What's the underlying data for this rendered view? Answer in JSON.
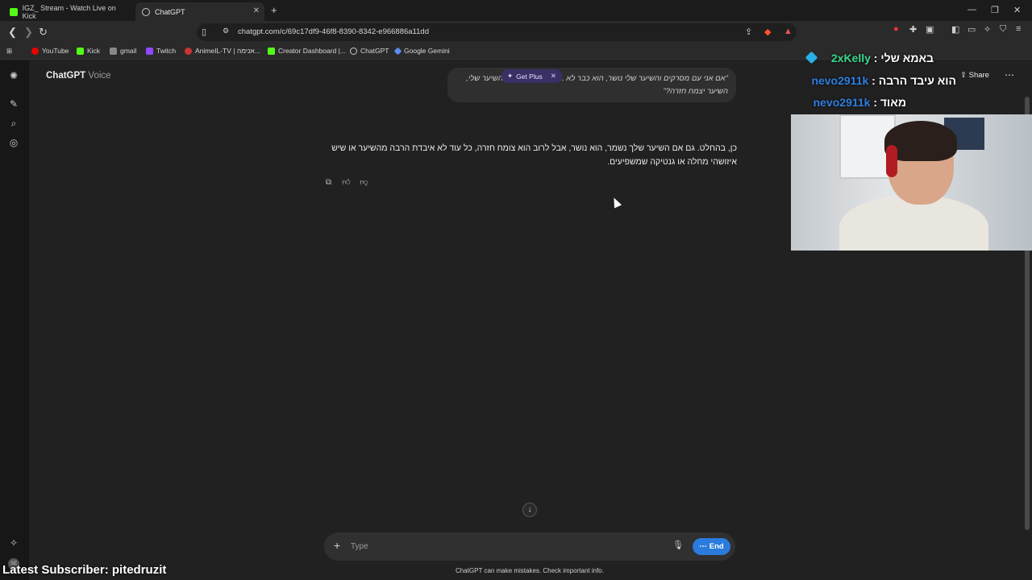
{
  "browser": {
    "tabs": [
      {
        "label": "IGZ_ Stream - Watch Live on Kick",
        "active": false
      },
      {
        "label": "ChatGPT",
        "active": true
      }
    ],
    "url": "chatgpt.com/c/69c17df9-46f8-8390-8342-e966886a11dd",
    "bookmarks": [
      "YouTube",
      "Kick",
      "gmail",
      "Twitch",
      "AnimeIL-TV | אנימה...",
      "Creator Dashboard |...",
      "ChatGPT",
      "Google Gemini"
    ]
  },
  "chatgpt": {
    "brand": "ChatGPT",
    "mode": "Voice",
    "user_message": "\"אם אני עם מסרקים והשיער שלי נושר, הוא כבר לא ... כשאני אגלח את השיער שלי, השיער יצמח חזרה?\"",
    "get_plus": "Get Plus",
    "assistant_message": "כן, בהחלט. גם אם השיער שלך נשמר, הוא נושר, אבל לרוב הוא צומח חזרה, כל עוד לא איבדת הרבה מהשיער או שיש איזושהי מחלה או גנטיקה שמשפיעים.",
    "composer_placeholder": "Type",
    "end_label": "End",
    "share_label": "Share",
    "footer": "ChatGPT can make mistakes. Check important info."
  },
  "stream_overlay": {
    "chat": [
      {
        "user": "2xKelly",
        "message": "באמא שלי",
        "user_color": "#39d98a"
      },
      {
        "user": "nevo2911k",
        "message": "הוא עיבד הרבה",
        "user_color": "#2f7fe0"
      },
      {
        "user": "nevo2911k",
        "message": "מאוד",
        "user_color": "#2f7fe0"
      }
    ],
    "latest_subscriber": "Latest Subscriber: pitedruzit"
  }
}
